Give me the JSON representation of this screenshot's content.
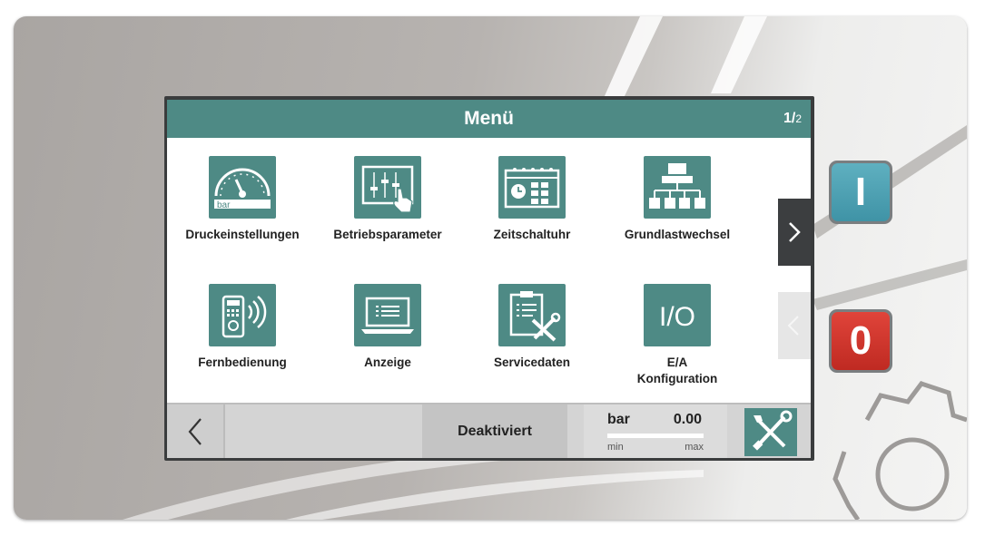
{
  "header": {
    "title": "Menü",
    "page_current": "1",
    "page_sep": "/",
    "page_total": "2"
  },
  "menu": {
    "items": [
      {
        "label": "Druckeinstellungen",
        "icon": "pressure-gauge-icon",
        "icon_text": "bar"
      },
      {
        "label": "Betriebsparameter",
        "icon": "sliders-hand-icon"
      },
      {
        "label": "Zeitschaltuhr",
        "icon": "calendar-clock-icon"
      },
      {
        "label": "Grundlastwechsel",
        "icon": "hierarchy-icon"
      },
      {
        "label": "Fernbedienung",
        "icon": "remote-control-icon"
      },
      {
        "label": "Anzeige",
        "icon": "laptop-icon"
      },
      {
        "label": "Servicedaten",
        "icon": "clipboard-tools-icon"
      },
      {
        "label": "E/A\nKonfiguration",
        "icon": "io-icon",
        "icon_text": "I/O"
      }
    ]
  },
  "footer": {
    "status": "Deaktiviert",
    "gauge": {
      "unit": "bar",
      "value": "0.00",
      "min_label": "min",
      "max_label": "max",
      "fill_fraction": 0
    }
  },
  "hardware": {
    "on_label": "I",
    "off_label": "0"
  },
  "colors": {
    "accent": "#4e8a85",
    "on_button": "#4aa0b3",
    "off_button": "#d33a31"
  }
}
